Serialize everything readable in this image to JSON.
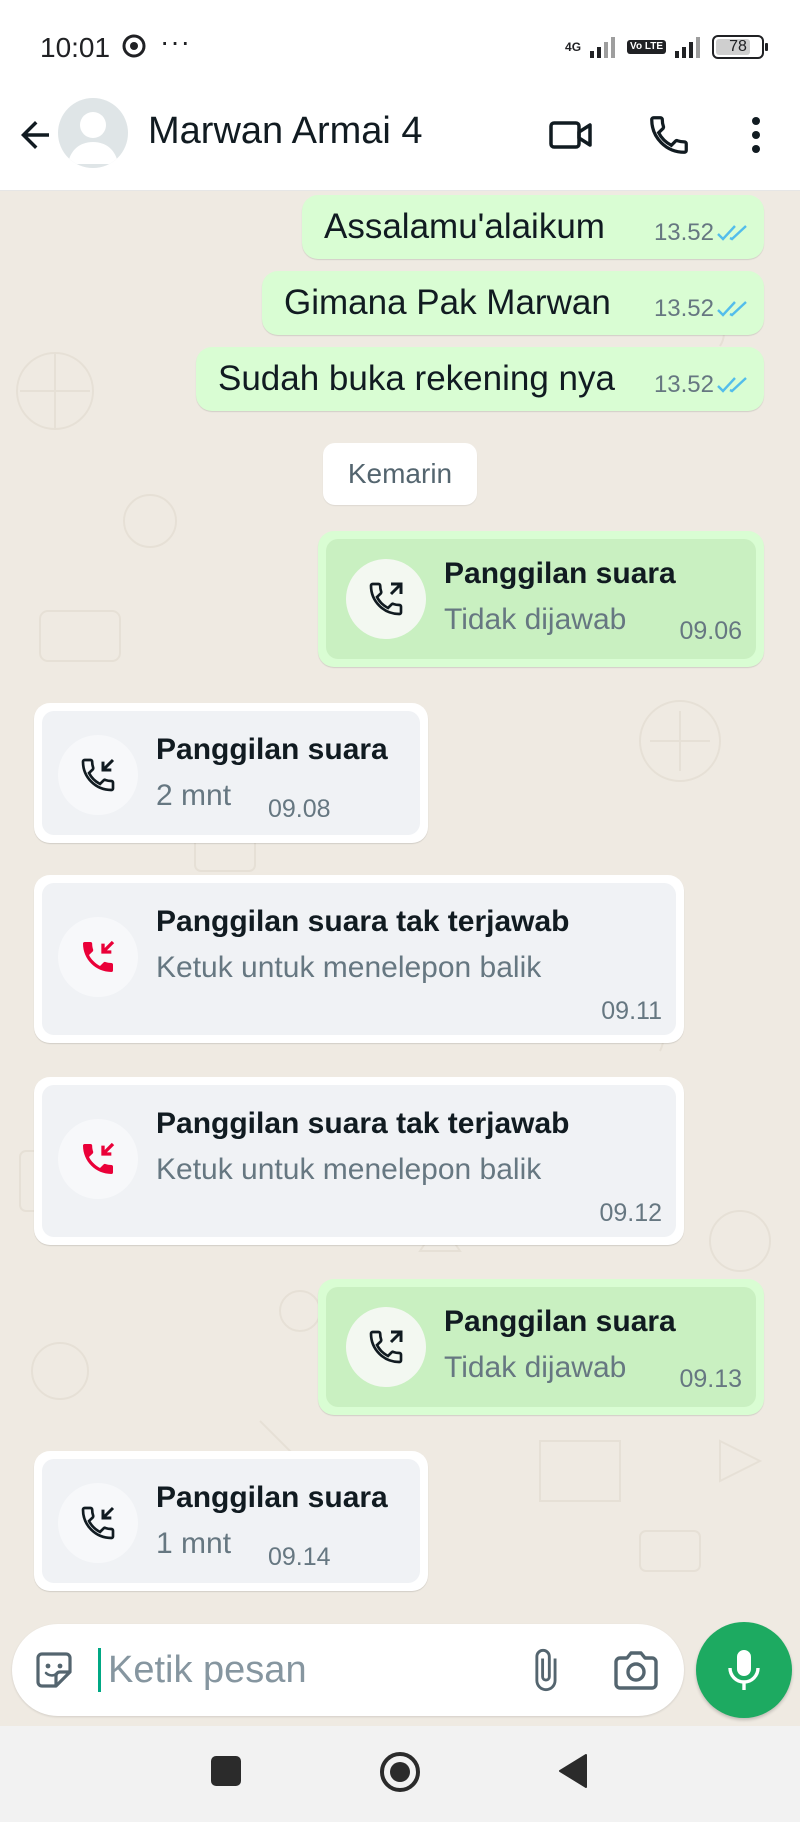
{
  "status_bar": {
    "time": "10:01",
    "more": "···",
    "network": "4G",
    "volte": "Vo LTE",
    "battery": "78",
    "battery_level_percent": 78
  },
  "header": {
    "contact_name": "Marwan Armai 4"
  },
  "messages": [
    {
      "text": "Assalamu'alaikum",
      "time": "13.52"
    },
    {
      "text": "Gimana Pak Marwan",
      "time": "13.52"
    },
    {
      "text": "Sudah buka rekening nya",
      "time": "13.52"
    }
  ],
  "date_divider": "Kemarin",
  "calls": [
    {
      "direction": "outgoing",
      "title": "Panggilan suara",
      "subtitle": "Tidak dijawab",
      "time": "09.06"
    },
    {
      "direction": "incoming",
      "title": "Panggilan suara",
      "subtitle": "2 mnt",
      "time": "09.08"
    },
    {
      "direction": "missed",
      "title": "Panggilan suara tak terjawab",
      "subtitle": "Ketuk untuk menelepon balik",
      "time": "09.11"
    },
    {
      "direction": "missed",
      "title": "Panggilan suara tak terjawab",
      "subtitle": "Ketuk untuk menelepon balik",
      "time": "09.12"
    },
    {
      "direction": "outgoing",
      "title": "Panggilan suara",
      "subtitle": "Tidak dijawab",
      "time": "09.13"
    },
    {
      "direction": "incoming",
      "title": "Panggilan suara",
      "subtitle": "1 mnt",
      "time": "09.14"
    }
  ],
  "input": {
    "placeholder": "Ketik pesan"
  },
  "colors": {
    "outgoing_bubble": "#d9fdd3",
    "incoming_bubble": "#ffffff",
    "read_ticks": "#53bdeb",
    "missed_call": "#ea0038",
    "accent": "#1daa61",
    "chat_background": "#efeae2"
  },
  "icons": {
    "back": "arrow-left",
    "video": "video-camera",
    "call": "phone",
    "menu": "vertical-dots",
    "emoji": "sticker-smiley",
    "attach": "paperclip",
    "camera": "camera",
    "mic": "microphone"
  }
}
